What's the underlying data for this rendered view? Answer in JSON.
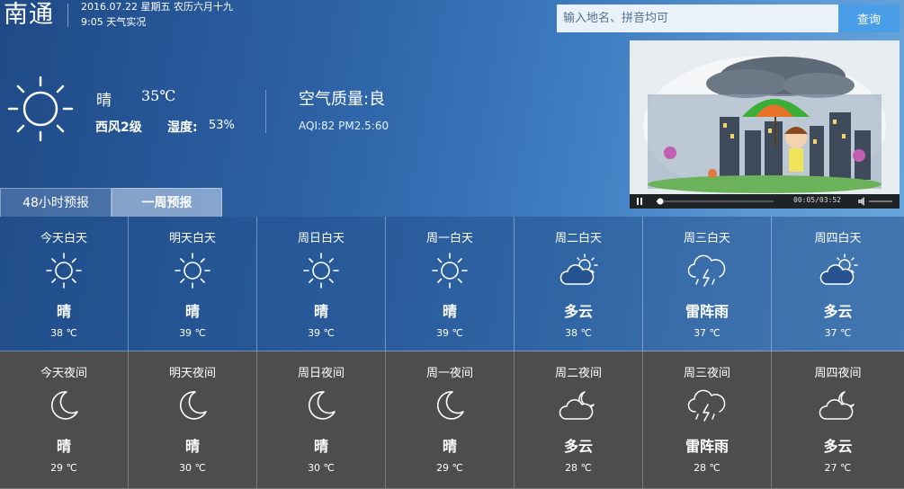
{
  "header": {
    "city": "南通",
    "date_line": "2016.07.22 星期五 农历六月十九",
    "time_line": "9:05 天气实况",
    "search_placeholder": "输入地名、拼音均可",
    "search_button": "查询"
  },
  "current": {
    "icon": "sun-icon",
    "condition": "晴",
    "temperature": "35℃",
    "wind": "西风2级",
    "humidity_label": "湿度:",
    "humidity_value": "53%",
    "air_quality": "空气质量:良",
    "aqi_line": "AQI:82 PM2.5:60"
  },
  "video": {
    "time": "00:05/03:52",
    "progress": 0.02
  },
  "tabs": [
    {
      "label": "48小时预报"
    },
    {
      "label": "一周预报"
    }
  ],
  "forecast": {
    "day": [
      {
        "label": "今天白天",
        "icon": "sun-icon",
        "condition": "晴",
        "temp": "38 ℃"
      },
      {
        "label": "明天白天",
        "icon": "sun-icon",
        "condition": "晴",
        "temp": "39 ℃"
      },
      {
        "label": "周日白天",
        "icon": "sun-icon",
        "condition": "晴",
        "temp": "39 ℃"
      },
      {
        "label": "周一白天",
        "icon": "sun-icon",
        "condition": "晴",
        "temp": "39 ℃"
      },
      {
        "label": "周二白天",
        "icon": "partly-cloudy-day-icon",
        "condition": "多云",
        "temp": "38 ℃"
      },
      {
        "label": "周三白天",
        "icon": "thunderstorm-icon",
        "condition": "雷阵雨",
        "temp": "37 ℃"
      },
      {
        "label": "周四白天",
        "icon": "partly-cloudy-day-icon",
        "condition": "多云",
        "temp": "37 ℃"
      }
    ],
    "night": [
      {
        "label": "今天夜间",
        "icon": "moon-icon",
        "condition": "晴",
        "temp": "29 ℃"
      },
      {
        "label": "明天夜间",
        "icon": "moon-icon",
        "condition": "晴",
        "temp": "30 ℃"
      },
      {
        "label": "周日夜间",
        "icon": "moon-icon",
        "condition": "晴",
        "temp": "30 ℃"
      },
      {
        "label": "周一夜间",
        "icon": "moon-icon",
        "condition": "晴",
        "temp": "29 ℃"
      },
      {
        "label": "周二夜间",
        "icon": "partly-cloudy-night-icon",
        "condition": "多云",
        "temp": "28 ℃"
      },
      {
        "label": "周三夜间",
        "icon": "thunderstorm-icon",
        "condition": "雷阵雨",
        "temp": "28 ℃"
      },
      {
        "label": "周四夜间",
        "icon": "partly-cloudy-night-icon",
        "condition": "多云",
        "temp": "27 ℃"
      }
    ]
  }
}
